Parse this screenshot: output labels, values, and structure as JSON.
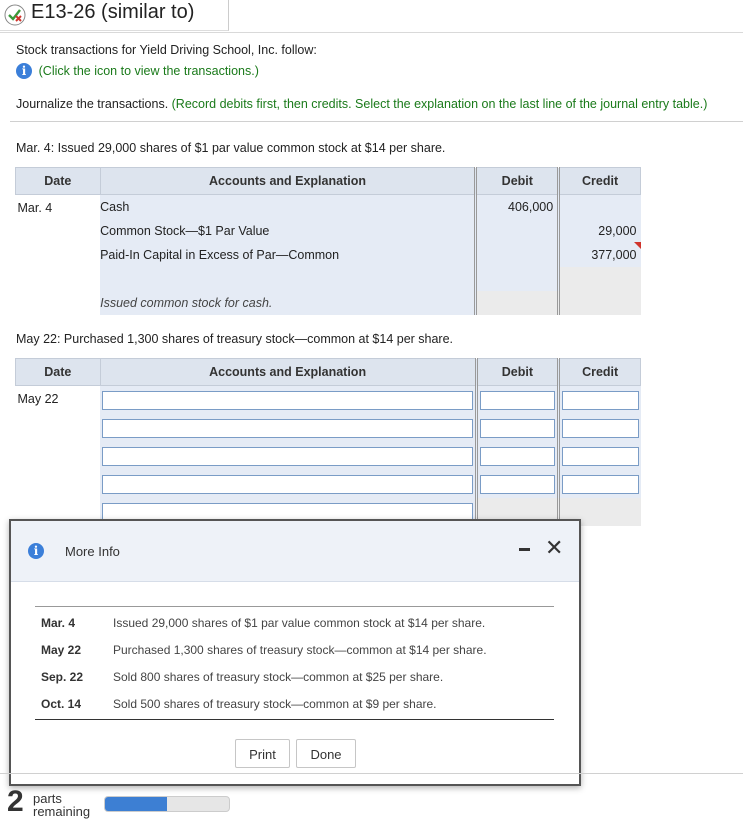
{
  "header": {
    "title": "E13-26 (similar to)",
    "status_icon": "partially-correct-icon"
  },
  "intro": {
    "text": "Stock transactions for Yield Driving School, Inc. follow:",
    "info_link": "(Click the icon to view the transactions.)"
  },
  "instruction": {
    "main": "Journalize the transactions. ",
    "detail": "(Record debits first, then credits. Select the explanation on the last line of the journal entry table.)"
  },
  "entry1": {
    "question": "Mar. 4: Issued 29,000 shares of $1 par value common stock at $14 per share.",
    "headers": {
      "date": "Date",
      "accounts": "Accounts and Explanation",
      "debit": "Debit",
      "credit": "Credit"
    },
    "date": "Mar. 4",
    "rows": [
      {
        "account": "Cash",
        "debit": "406,000",
        "credit": ""
      },
      {
        "account": "Common Stock—$1 Par Value",
        "debit": "",
        "credit": "29,000"
      },
      {
        "account": "Paid-In Capital in Excess of Par—Common",
        "debit": "",
        "credit": "377,000"
      }
    ],
    "explanation": "Issued common stock for cash."
  },
  "entry2": {
    "question": "May 22: Purchased 1,300 shares of treasury stock—common at $14 per share.",
    "headers": {
      "date": "Date",
      "accounts": "Accounts and Explanation",
      "debit": "Debit",
      "credit": "Credit"
    },
    "date": "May 22"
  },
  "modal": {
    "title": "More Info",
    "transactions": [
      {
        "date": "Mar. 4",
        "text": "Issued 29,000 shares of $1 par value common stock at $14 per share."
      },
      {
        "date": "May 22",
        "text": "Purchased 1,300 shares of treasury stock—common at $14 per share."
      },
      {
        "date": "Sep. 22",
        "text": "Sold 800 shares of treasury stock—common at $25 per share."
      },
      {
        "date": "Oct. 14",
        "text": "Sold 500 shares of treasury stock—common at $9 per share."
      }
    ],
    "print_label": "Print",
    "done_label": "Done"
  },
  "footer": {
    "parts_count": "2",
    "parts_label_line1": "parts",
    "parts_label_line2": "remaining",
    "progress_fraction": 0.5
  },
  "colors": {
    "accent_green": "#1a7a1a",
    "info_blue": "#3b7fd9",
    "progress_blue": "#3d7fd3",
    "table_header": "#dde4ee",
    "table_body": "#e5ebf5"
  }
}
